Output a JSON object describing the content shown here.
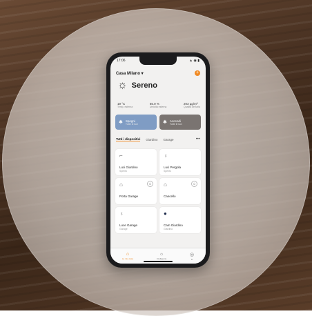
{
  "status": {
    "time": "17:06",
    "icons": "▲ ◉ ▮"
  },
  "header": {
    "home_name": "Casa Milano ▾",
    "add_icon": "+"
  },
  "weather": {
    "icon": "sun-icon",
    "title": "Sereno"
  },
  "stats": [
    {
      "value": "19 °C",
      "label": "Temp. esterna"
    },
    {
      "value": "65.0 %",
      "label": "Umidità esterna"
    },
    {
      "value": "203 µg/m³",
      "label": "Qualità dell'aria"
    }
  ],
  "scenes": [
    {
      "title": "Spegni",
      "subtitle": "Tutte le luci",
      "color": "#7f9cc4"
    },
    {
      "title": "Accendi",
      "subtitle": "Tutte le luci",
      "color": "#7a7471"
    }
  ],
  "tabs": [
    {
      "label": "Tutti i dispositivi",
      "active": true
    },
    {
      "label": "Giardino"
    },
    {
      "label": "Garage"
    }
  ],
  "more_icon": "•••",
  "devices": [
    {
      "name": "Luci Giardino",
      "status": "Spento",
      "icon": "lamp-icon"
    },
    {
      "name": "Luci Pergola",
      "status": "Spento",
      "icon": "bulb-icon"
    },
    {
      "name": "Porta Garage",
      "status": "",
      "icon": "garage-icon"
    },
    {
      "name": "Cancello",
      "status": "",
      "icon": "gate-icon"
    },
    {
      "name": "Luce Garage",
      "status": "Garage",
      "icon": "bulb-icon"
    },
    {
      "name": "Cam Giardino",
      "status": "Giardino",
      "icon": "camera-icon"
    }
  ],
  "nav": [
    {
      "label": "La mia casa",
      "active": true
    },
    {
      "label": "Intelligente"
    },
    {
      "label": "Io"
    }
  ],
  "colors": {
    "accent": "#f08a24"
  }
}
